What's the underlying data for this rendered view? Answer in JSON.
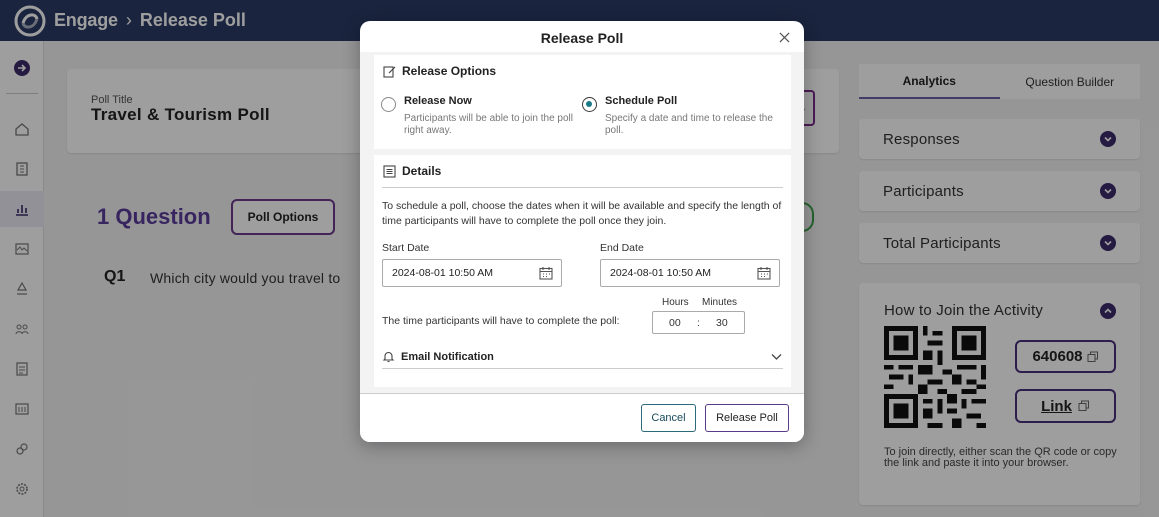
{
  "header": {
    "brand": "Engage",
    "separator": "›",
    "breadcrumb": "Release Poll"
  },
  "main": {
    "poll_title_label": "Poll Title",
    "poll_title": "Travel & Tourism Poll",
    "question_count": "1 Question",
    "poll_options_label": "Poll Options",
    "q_number": "Q1",
    "q_text": "Which city would you travel to"
  },
  "right_panel": {
    "tabs": [
      {
        "label": "Analytics",
        "active": true
      },
      {
        "label": "Question Builder",
        "active": false
      }
    ],
    "accordions": [
      {
        "label": "Responses"
      },
      {
        "label": "Participants"
      },
      {
        "label": "Total Participants"
      }
    ],
    "join": {
      "title": "How to Join the Activity",
      "code": "640608",
      "link_label": "Link",
      "note": "To join directly, either scan the QR code or copy the link and paste it into your browser."
    }
  },
  "modal": {
    "title": "Release Poll",
    "release_options": {
      "heading": "Release Options",
      "options": [
        {
          "label": "Release Now",
          "description": "Participants will be able to join the poll right away.",
          "selected": false
        },
        {
          "label": "Schedule Poll",
          "description": "Specify a date and time to release the poll.",
          "selected": true
        }
      ]
    },
    "details": {
      "heading": "Details",
      "intro": "To schedule a poll, choose the dates when it will be available and specify the length of time participants will have to complete the poll once they join.",
      "start_label": "Start Date",
      "start_value": "2024-08-01 10:50 AM",
      "end_label": "End Date",
      "end_value": "2024-08-01 10:50 AM",
      "hours_label": "Hours",
      "minutes_label": "Minutes",
      "time_label": "The time participants will have to complete the poll:",
      "hours_value": "00",
      "separator": ":",
      "minutes_value": "30",
      "email_label": "Email Notification"
    },
    "cancel_label": "Cancel",
    "release_label": "Release Poll"
  },
  "colors": {
    "topbar": "#2a3b64",
    "accent_purple": "#5b3c9a",
    "radio_selected": "#1a7a86"
  }
}
